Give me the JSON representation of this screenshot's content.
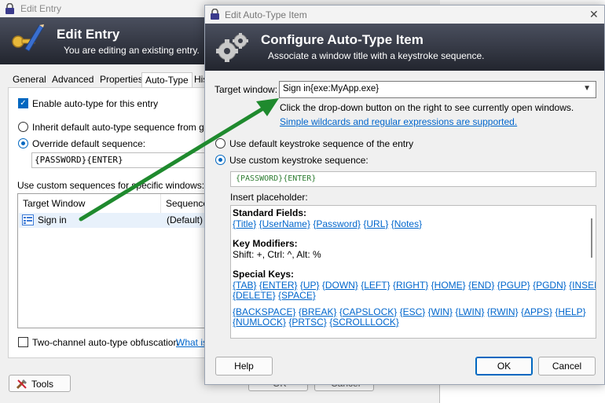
{
  "back_window": {
    "title": "Edit Entry",
    "banner_title": "Edit Entry",
    "banner_subtitle": "You are editing an existing entry.",
    "tabs": [
      {
        "label": "General"
      },
      {
        "label": "Advanced"
      },
      {
        "label": "Properties"
      },
      {
        "label": "Auto-Type"
      },
      {
        "label": "His"
      }
    ],
    "enable_autotype_label": "Enable auto-type for this entry",
    "inherit_label": "Inherit default auto-type sequence from group",
    "override_label": "Override default sequence:",
    "sequence_value": "{PASSWORD}{ENTER}",
    "custom_sequences_label": "Use custom sequences for specific windows:",
    "list_headers": {
      "target_window": "Target Window",
      "sequence": "Sequence"
    },
    "list_rows": [
      {
        "target": "Sign in",
        "sequence": "(Default)"
      }
    ],
    "two_channel_label": "Two-channel auto-type obfuscation",
    "what_is_link": "What is",
    "tools_button": "Tools",
    "ok_button_partial": "OK",
    "cancel_button_partial": "Cancel"
  },
  "dialog": {
    "title": "Edit Auto-Type Item",
    "banner_title": "Configure Auto-Type Item",
    "banner_subtitle": "Associate a window title with a keystroke sequence.",
    "target_window_label": "Target window:",
    "target_window_value": "Sign in{exe:MyApp.exe}",
    "hint_text": "Click the drop-down button on the right to see currently open windows.",
    "wildcards_link": "Simple wildcards and regular expressions are supported.",
    "default_seq_label": "Use default keystroke sequence of the entry",
    "custom_seq_label": "Use custom keystroke sequence:",
    "custom_seq_value": "{PASSWORD}{ENTER}",
    "insert_placeholder_label": "Insert placeholder:",
    "placeholders": {
      "standard_fields_header": "Standard Fields:",
      "standard_fields": [
        "{Title}",
        "{UserName}",
        "{Password}",
        "{URL}",
        "{Notes}"
      ],
      "key_modifiers_header": "Key Modifiers:",
      "key_modifiers_text": "Shift: +, Ctrl: ^, Alt: %",
      "special_keys_header": "Special Keys:",
      "special_keys_row1": [
        "{TAB}",
        "{ENTER}",
        "{UP}",
        "{DOWN}",
        "{LEFT}",
        "{RIGHT}",
        "{HOME}",
        "{END}",
        "{PGUP}",
        "{PGDN}",
        "{INSERT}"
      ],
      "special_keys_row2": [
        "{DELETE}",
        "{SPACE}"
      ],
      "special_keys_row3": [
        "{BACKSPACE}",
        "{BREAK}",
        "{CAPSLOCK}",
        "{ESC}",
        "{WIN}",
        "{LWIN}",
        "{RWIN}",
        "{APPS}",
        "{HELP}"
      ],
      "special_keys_row4": [
        "{NUMLOCK}",
        "{PRTSC}",
        "{SCROLLLOCK}"
      ]
    },
    "help_button": "Help",
    "ok_button": "OK",
    "cancel_button": "Cancel",
    "close_glyph": "✕"
  },
  "annotation": {
    "arrow_color": "#1f8a2e"
  }
}
